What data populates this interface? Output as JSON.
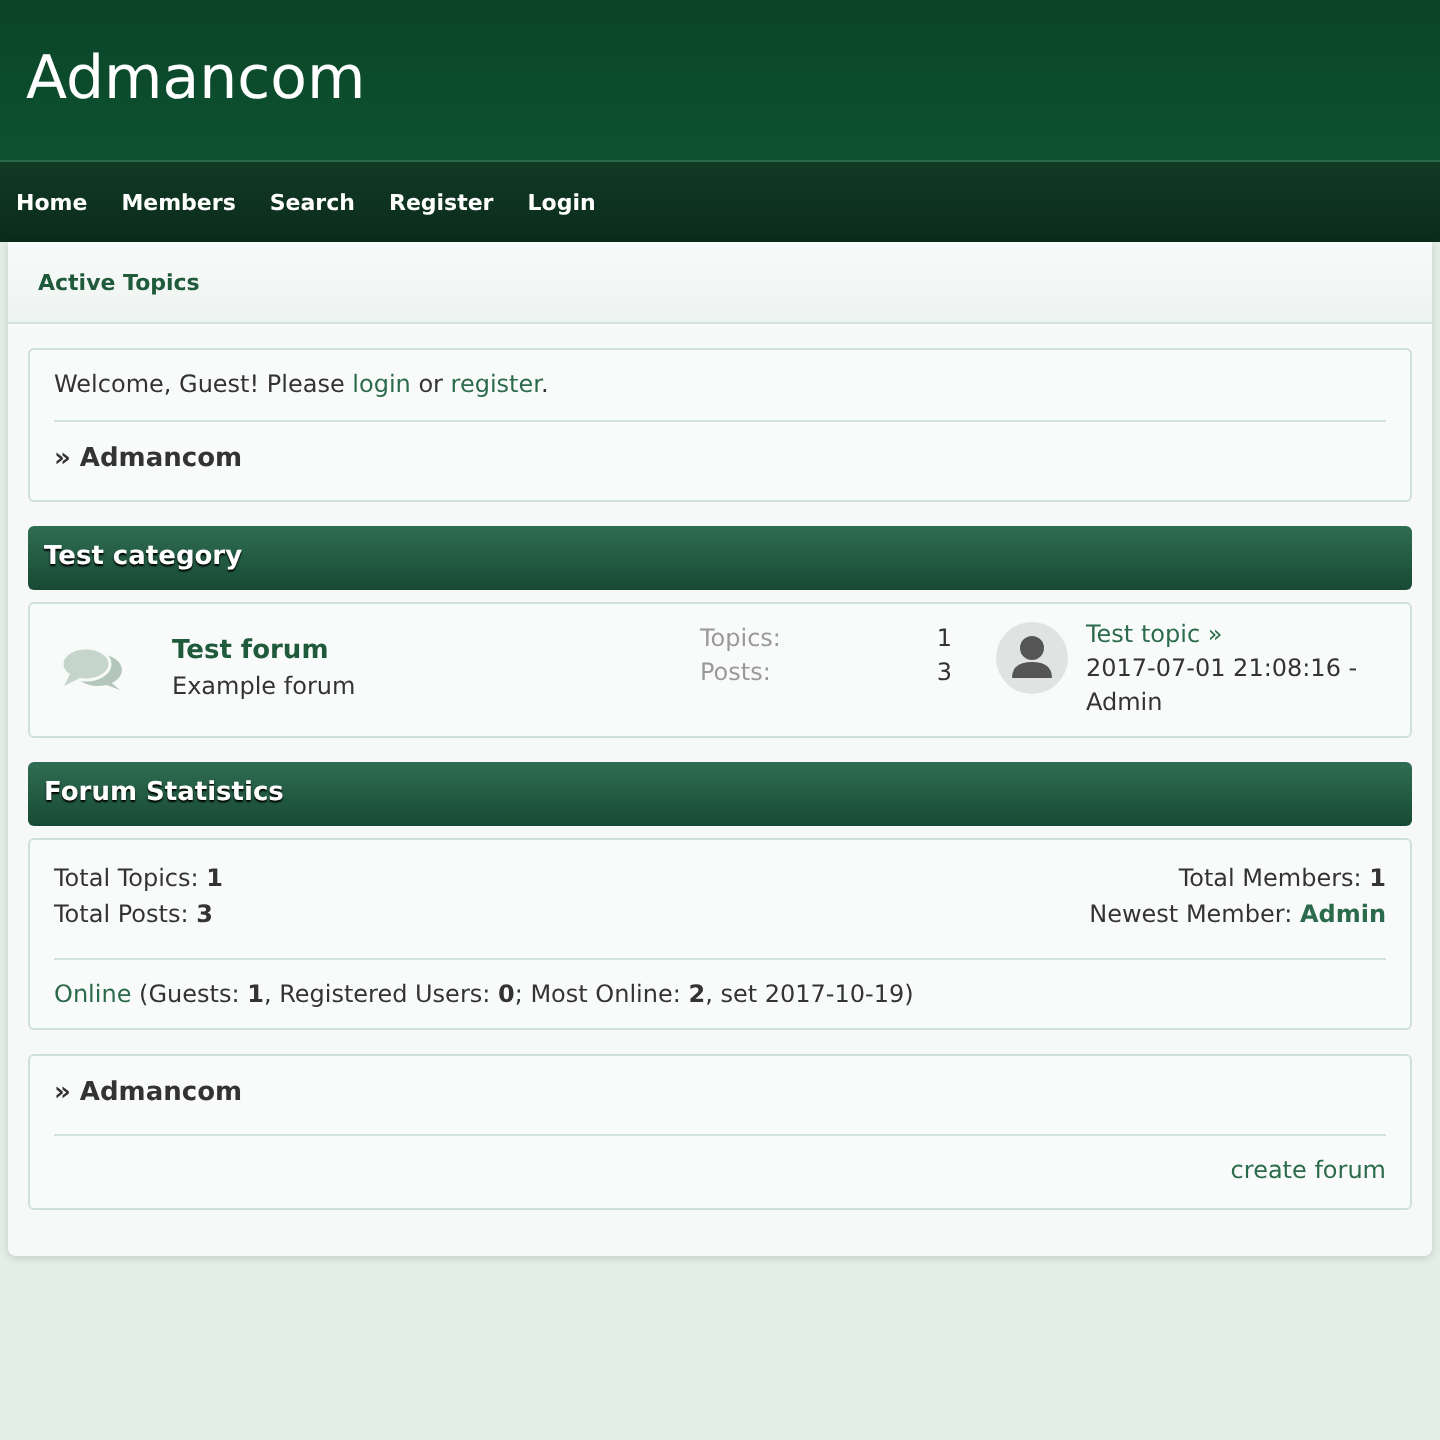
{
  "site_title": "Admancom",
  "nav": [
    {
      "label": "Home"
    },
    {
      "label": "Members"
    },
    {
      "label": "Search"
    },
    {
      "label": "Register"
    },
    {
      "label": "Login"
    }
  ],
  "subnav": [
    {
      "label": "Active Topics"
    }
  ],
  "welcome": {
    "text_1": "Welcome, Guest!   Please",
    "login_link": "login",
    "text_2": "or",
    "register_link": "register",
    "text_3": ".",
    "breadcrumb": "» Admancom"
  },
  "categories": [
    {
      "title": "Test category",
      "forums": [
        {
          "name": "Test forum",
          "description": "Example forum",
          "topics_label": "Topics:",
          "topics": "1",
          "posts_label": "Posts:",
          "posts": "3",
          "last_post": "Test topic »",
          "last_post_info": "2017-07-01 21:08:16 - Admin"
        }
      ]
    }
  ],
  "statistics": {
    "title": "Forum Statistics",
    "total_topics": "Total Topics: **1**",
    "total_posts": "Total Posts: **3**",
    "total_members": "Total Members: **1**",
    "newest_member_label": "Newest Member:",
    "newest_member": "Admin",
    "online_link": "Online",
    "online_text": "(Guests: **1**, Registered Users: **0**; Most Online: **2**, set 2017-10-19)"
  },
  "footer_box": {
    "breadcrumb": "» Admancom",
    "create_link": "create forum"
  }
}
